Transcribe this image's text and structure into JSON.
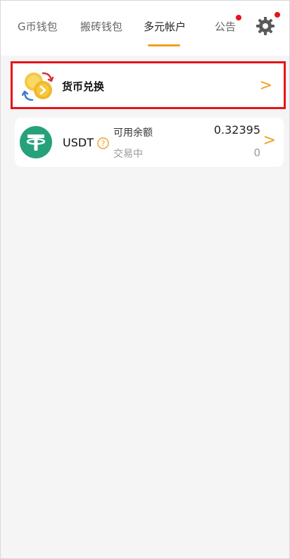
{
  "tabs": [
    {
      "label": "G币钱包",
      "active": false
    },
    {
      "label": "搬砖钱包",
      "active": false
    },
    {
      "label": "多元帐户",
      "active": true
    },
    {
      "label": "公告",
      "active": false
    }
  ],
  "header": {
    "settings_icon": "gear-icon",
    "accent_color": "#f0a020",
    "notification_color": "#e8141b"
  },
  "exchange": {
    "label": "货币兑换",
    "icon": "currency-exchange-icon"
  },
  "asset": {
    "name": "USDT",
    "icon": "tether-icon",
    "brand_color": "#26a17b",
    "available_label": "可用余额",
    "available_value": "0.32395",
    "trading_label": "交易中",
    "trading_value": "0"
  },
  "chevron": ">"
}
